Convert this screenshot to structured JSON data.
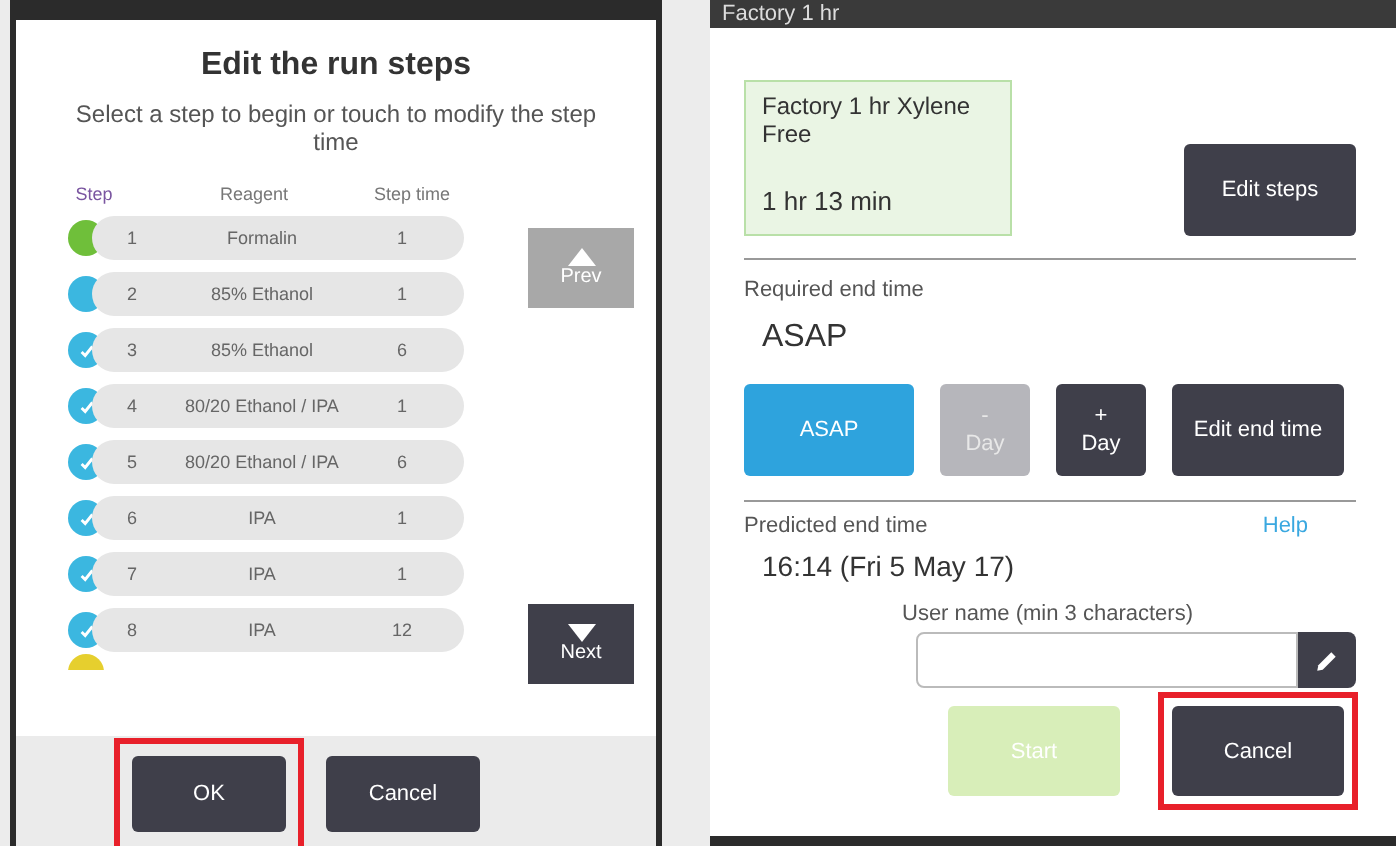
{
  "steps_dialog": {
    "title": "Edit the run steps",
    "subtitle": "Select a step to begin or touch to modify the step time",
    "columns": [
      "Step",
      "Reagent",
      "Step time"
    ],
    "steps": [
      {
        "step": "1",
        "reagent": "Formalin",
        "time": "1",
        "kind": "start"
      },
      {
        "step": "2",
        "reagent": "85% Ethanol",
        "time": "1",
        "kind": "pending"
      },
      {
        "step": "3",
        "reagent": "85% Ethanol",
        "time": "6",
        "kind": "done"
      },
      {
        "step": "4",
        "reagent": "80/20 Ethanol / IPA",
        "time": "1",
        "kind": "done"
      },
      {
        "step": "5",
        "reagent": "80/20 Ethanol / IPA",
        "time": "6",
        "kind": "done"
      },
      {
        "step": "6",
        "reagent": "IPA",
        "time": "1",
        "kind": "done"
      },
      {
        "step": "7",
        "reagent": "IPA",
        "time": "1",
        "kind": "done"
      },
      {
        "step": "8",
        "reagent": "IPA",
        "time": "12",
        "kind": "done"
      }
    ],
    "cut_off_row": {
      "color": "#e6cf2e"
    },
    "prev_button": {
      "label": "Prev",
      "disabled": true
    },
    "next_button": {
      "label": "Next",
      "disabled": false
    },
    "buttons": [
      {
        "label": "OK",
        "highlighted": true
      },
      {
        "label": "Cancel",
        "highlighted": false
      }
    ]
  },
  "run_panel": {
    "header_text": "Factory 1 hr",
    "protocol": {
      "name": "Factory 1 hr Xylene Free",
      "duration": "1 hr 13 min"
    },
    "edit_steps": "Edit steps",
    "required_label": "Required end time",
    "required_value": "ASAP",
    "time_buttons": [
      {
        "top": "ASAP",
        "kind": "primary"
      },
      {
        "top": "-",
        "bottom": "Day",
        "kind": "disabled"
      },
      {
        "top": "+",
        "bottom": "Day",
        "kind": "normal"
      },
      {
        "top": "Edit end time",
        "kind": "normal"
      }
    ],
    "predicted_label": "Predicted end time",
    "help": "Help",
    "predicted_value": "16:14 (Fri 5 May 17)",
    "user_label": "User name (min 3 characters)",
    "start": {
      "label": "Start",
      "disabled": true
    },
    "cancel": {
      "label": "Cancel",
      "highlighted": true
    }
  }
}
